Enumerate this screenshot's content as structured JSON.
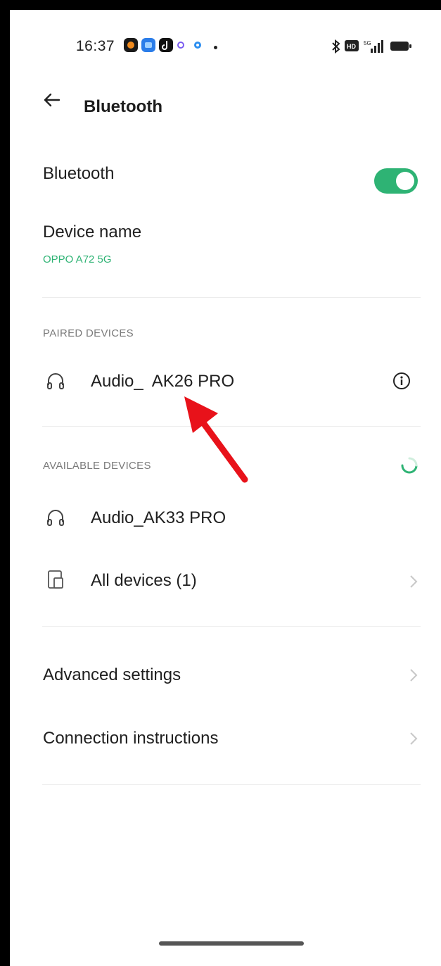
{
  "status_bar": {
    "time": "16:37",
    "icons_left": [
      "orange-app-icon",
      "blue-app-icon",
      "tiktok-icon",
      "ring-icon",
      "ring-icon",
      "dot-icon"
    ],
    "icons_right": [
      "bluetooth-icon",
      "hd-icon",
      "signal-icon",
      "battery-icon"
    ],
    "network_label": "5G"
  },
  "header": {
    "title": "Bluetooth"
  },
  "bluetooth_toggle": {
    "label": "Bluetooth",
    "enabled": true
  },
  "device_name": {
    "label": "Device name",
    "value": "OPPO A72 5G"
  },
  "paired": {
    "header": "PAIRED DEVICES",
    "devices": [
      {
        "name": "Audio_  AK26 PRO",
        "icon": "headphones-icon"
      }
    ]
  },
  "available": {
    "header": "AVAILABLE DEVICES",
    "devices": [
      {
        "name": "Audio_AK33 PRO",
        "icon": "headphones-icon"
      }
    ],
    "all_devices": "All devices (1)"
  },
  "settings": {
    "advanced": "Advanced settings",
    "instructions": "Connection instructions"
  },
  "colors": {
    "accent": "#2eb374",
    "annotation_arrow": "#e8121a"
  }
}
